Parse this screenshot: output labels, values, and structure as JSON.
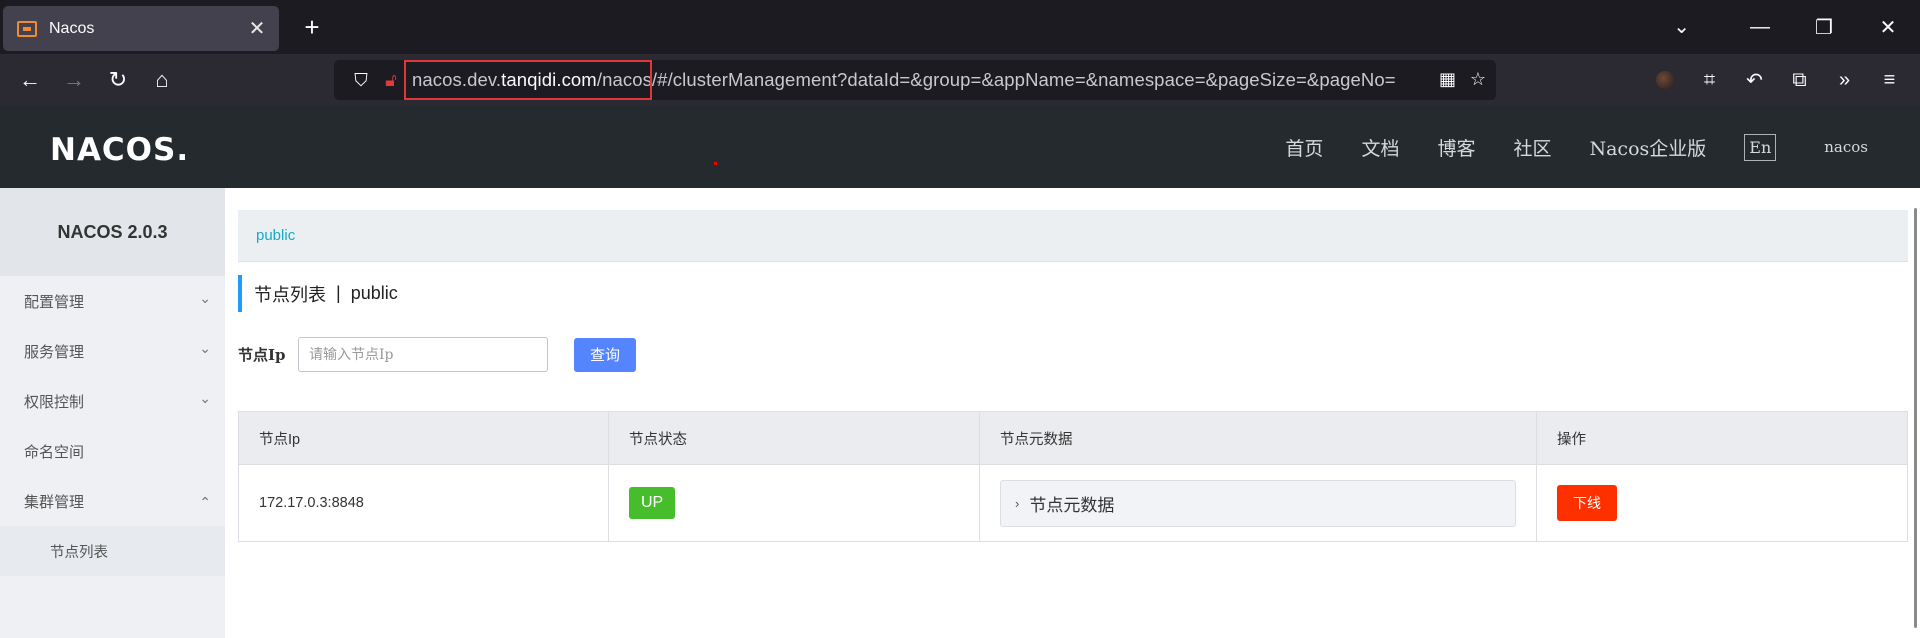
{
  "browser": {
    "tab_title": "Nacos",
    "tab_close": "✕",
    "new_tab": "+",
    "url_prefix": "nacos.dev.",
    "url_host": "tanqidi.com",
    "url_path": "/nacos/#/clusterManagement?dataId=&group=&appName=&namespace=&pageSize=&pageNo="
  },
  "header": {
    "logo": "NACOS.",
    "nav": [
      "首页",
      "文档",
      "博客",
      "社区",
      "Nacos企业版"
    ],
    "lang": "En",
    "user": "nacos"
  },
  "sidebar": {
    "title": "NACOS 2.0.3",
    "items": [
      {
        "label": "配置管理",
        "chevron": "⌄"
      },
      {
        "label": "服务管理",
        "chevron": "⌄"
      },
      {
        "label": "权限控制",
        "chevron": "⌄"
      },
      {
        "label": "命名空间",
        "chevron": ""
      },
      {
        "label": "集群管理",
        "chevron": "⌃"
      }
    ],
    "subitems": [
      "节点列表"
    ]
  },
  "content": {
    "breadcrumb": "public",
    "title": "节点列表",
    "title_sep": "|",
    "title_namespace": "public",
    "search": {
      "label": "节点Ip",
      "placeholder": "请输入节点Ip",
      "button": "查询"
    },
    "table": {
      "columns": [
        "节点Ip",
        "节点状态",
        "节点元数据",
        "操作"
      ],
      "rows": [
        {
          "ip": "172.17.0.3:8848",
          "status": "UP",
          "metadata": "节点元数据",
          "action": "下线"
        }
      ]
    }
  },
  "colors": {
    "accent": "#5584ff",
    "status_up": "#46be2c",
    "danger": "#ff3000",
    "breadcrumb": "#13abc9"
  }
}
